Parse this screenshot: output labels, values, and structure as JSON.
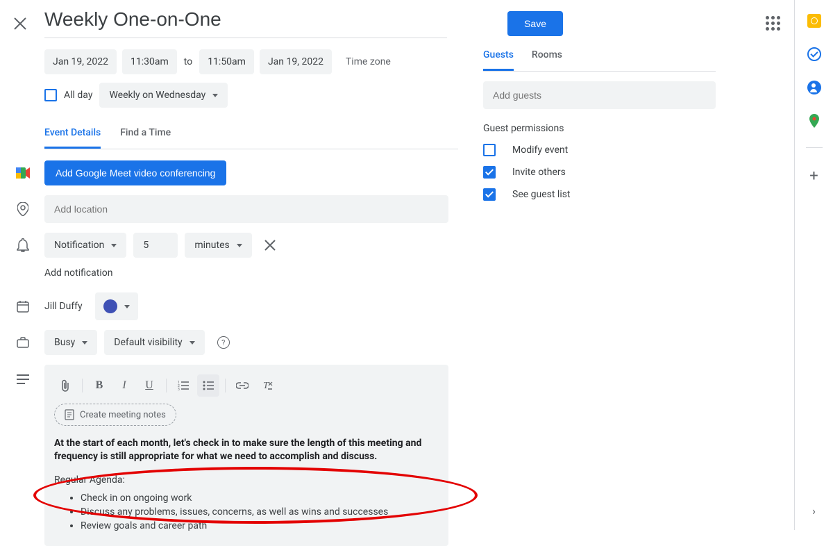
{
  "header": {
    "title": "Weekly One-on-One",
    "save_label": "Save"
  },
  "datetime": {
    "start_date": "Jan 19, 2022",
    "start_time": "11:30am",
    "to_label": "to",
    "end_time": "11:50am",
    "end_date": "Jan 19, 2022",
    "timezone_label": "Time zone"
  },
  "allday": {
    "label": "All day",
    "recurrence": "Weekly on Wednesday"
  },
  "tabs": {
    "details": "Event Details",
    "findtime": "Find a Time"
  },
  "conferencing": {
    "add_meet": "Add Google Meet video conferencing"
  },
  "location": {
    "placeholder": "Add location"
  },
  "notification": {
    "type": "Notification",
    "value": "5",
    "unit": "minutes",
    "add_label": "Add notification"
  },
  "owner": {
    "name": "Jill Duffy"
  },
  "availability": {
    "busy": "Busy",
    "visibility": "Default visibility"
  },
  "description": {
    "create_notes": "Create meeting notes",
    "bold_text": "At the start of each month, let's check in to make sure the length of this meeting and frequency is still appropriate for what we need to accomplish and discuss.",
    "agenda_header": "Regular Agenda:",
    "agenda_items": [
      "Check in on ongoing work",
      "Discuss any problems, issues, concerns, as well as wins and successes",
      "Review goals and career path"
    ]
  },
  "guests": {
    "tab_guests": "Guests",
    "tab_rooms": "Rooms",
    "placeholder": "Add guests",
    "perm_header": "Guest permissions",
    "perm_modify": "Modify event",
    "perm_invite": "Invite others",
    "perm_seelist": "See guest list"
  }
}
